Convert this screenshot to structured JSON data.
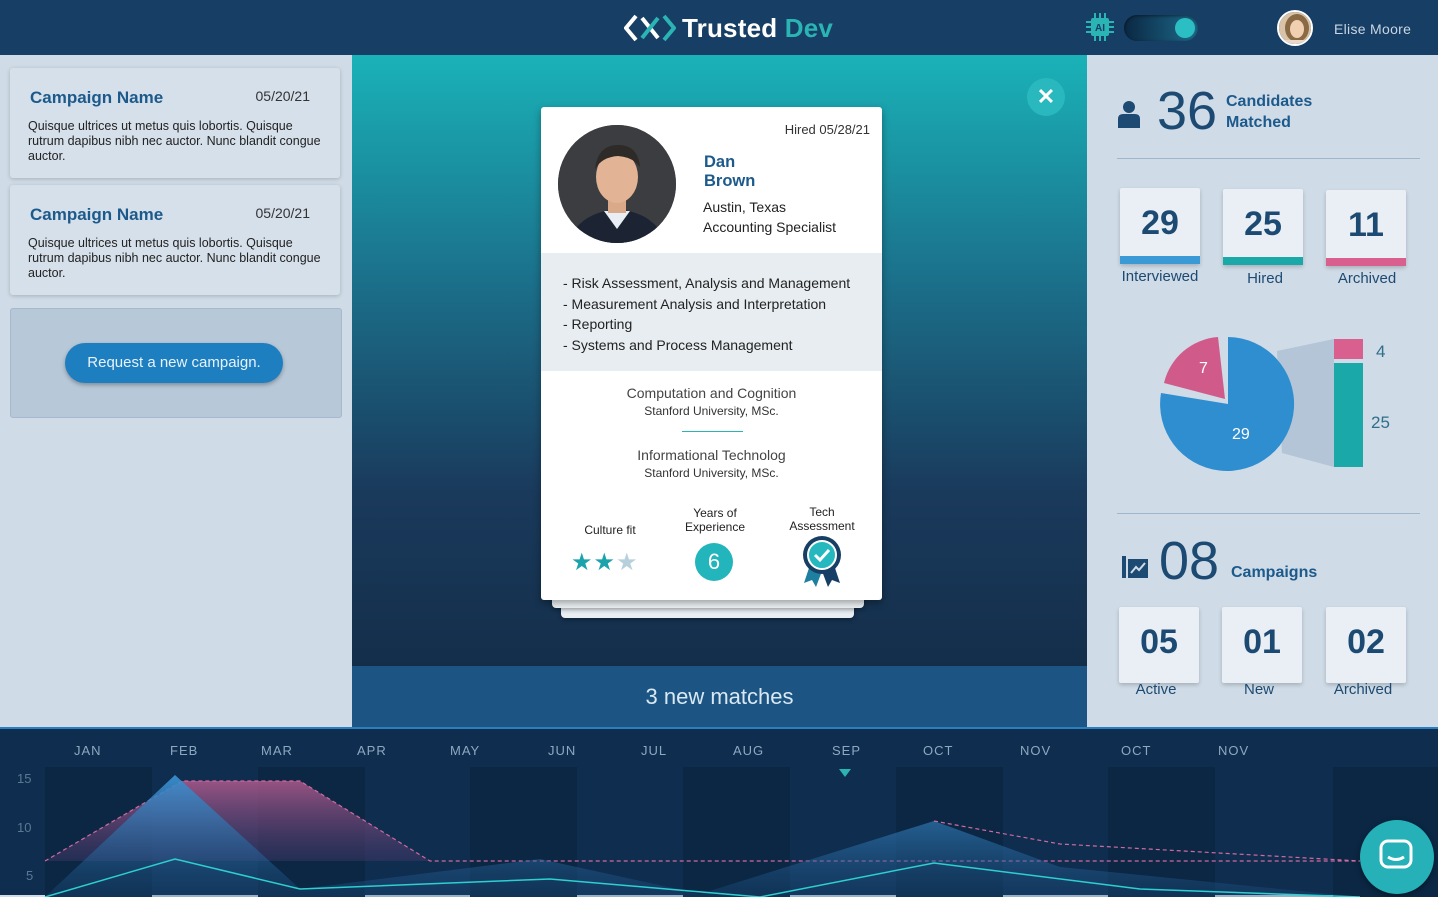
{
  "header": {
    "logo_text_main": "Trusted",
    "logo_text_accent": "Dev",
    "ai_label": "AI",
    "user_name": "Elise Moore"
  },
  "campaigns": [
    {
      "name": "Campaign Name",
      "date": "05/20/21",
      "description": "Quisque ultrices ut metus quis lobortis. Quisque rutrum dapibus nibh nec auctor. Nunc blandit congue auctor."
    },
    {
      "name": "Campaign Name",
      "date": "05/20/21",
      "description": "Quisque ultrices ut metus quis lobortis. Quisque rutrum dapibus nibh nec auctor. Nunc blandit congue auctor."
    }
  ],
  "request_button": "Request a new campaign.",
  "candidate": {
    "hired": "Hired 05/28/21",
    "first_name": "Dan",
    "last_name": "Brown",
    "location": "Austin, Texas",
    "title": "Accounting Specialist",
    "skills": [
      "- Risk Assessment, Analysis and Management",
      "- Measurement Analysis and Interpretation",
      "- Reporting",
      "- Systems and Process Management"
    ],
    "education": [
      {
        "field": "Computation and Cognition",
        "school": "Stanford University, MSc."
      },
      {
        "field": "Informational Technolog",
        "school": "Stanford University, MSc."
      }
    ],
    "culture_fit_label": "Culture fit",
    "culture_fit_stars": 2,
    "culture_fit_max": 3,
    "years_label_1": "Years of",
    "years_label_2": "Experience",
    "years": "6",
    "tech_label_1": "Tech",
    "tech_label_2": "Assessment"
  },
  "new_matches": "3 new matches",
  "stats": {
    "candidates_count": "36",
    "candidates_label_1": "Candidates",
    "candidates_label_2": "Matched",
    "tiles": [
      {
        "value": "29",
        "label": "Interviewed",
        "color": "#3a9ad6"
      },
      {
        "value": "25",
        "label": "Hired",
        "color": "#1ba8a8"
      },
      {
        "value": "11",
        "label": "Archived",
        "color": "#d9608e"
      }
    ],
    "pie": {
      "large": "29",
      "small": "7",
      "stack_top": "4",
      "stack_bottom": "25"
    },
    "campaigns_count": "08",
    "campaigns_label": "Campaigns",
    "campaign_tiles": [
      {
        "value": "05",
        "label": "Active"
      },
      {
        "value": "01",
        "label": "New"
      },
      {
        "value": "02",
        "label": "Archived"
      }
    ]
  },
  "timeline": {
    "months": [
      "JAN",
      "FEB",
      "MAR",
      "APR",
      "MAY",
      "JUN",
      "JUL",
      "AUG",
      "SEP",
      "OCT",
      "NOV",
      "OCT",
      "NOV"
    ],
    "yticks": [
      "15",
      "10",
      "5"
    ]
  },
  "colors": {
    "accent": "#2ab4b4",
    "primary": "#1d5a8c",
    "pink": "#d9608e",
    "blue": "#3a9ad6"
  }
}
